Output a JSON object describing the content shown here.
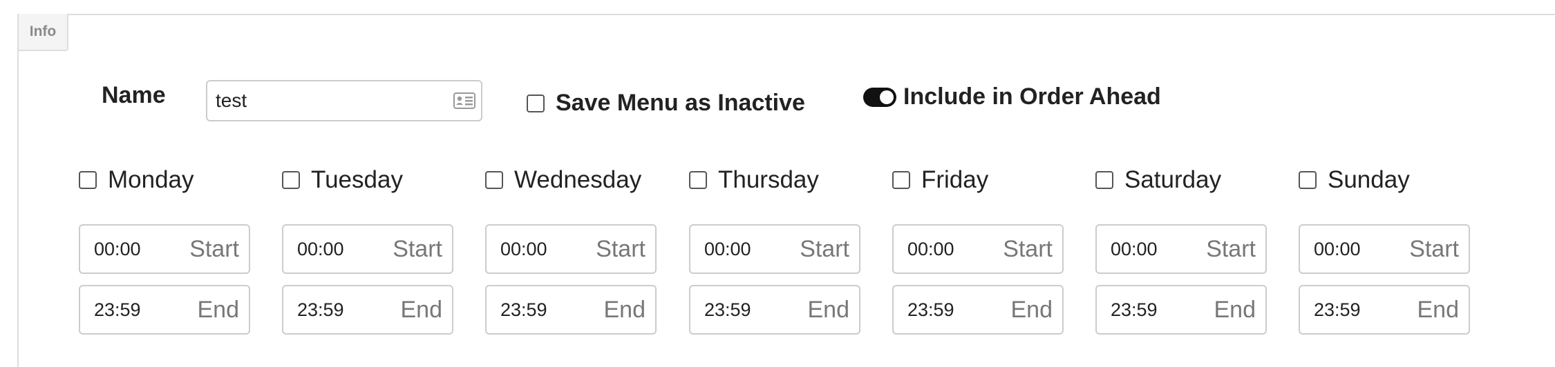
{
  "tab": {
    "label": "Info"
  },
  "name": {
    "label": "Name",
    "value": "test",
    "icon": "contact-card-icon"
  },
  "inactive": {
    "label": "Save Menu as Inactive",
    "checked": false
  },
  "order_ahead": {
    "label": "Include in Order Ahead",
    "enabled": true
  },
  "days": [
    {
      "label": "Monday",
      "checked": false,
      "start": "00:00",
      "start_tag": "Start",
      "end": "23:59",
      "end_tag": "End"
    },
    {
      "label": "Tuesday",
      "checked": false,
      "start": "00:00",
      "start_tag": "Start",
      "end": "23:59",
      "end_tag": "End"
    },
    {
      "label": "Wednesday",
      "checked": false,
      "start": "00:00",
      "start_tag": "Start",
      "end": "23:59",
      "end_tag": "End"
    },
    {
      "label": "Thursday",
      "checked": false,
      "start": "00:00",
      "start_tag": "Start",
      "end": "23:59",
      "end_tag": "End"
    },
    {
      "label": "Friday",
      "checked": false,
      "start": "00:00",
      "start_tag": "Start",
      "end": "23:59",
      "end_tag": "End"
    },
    {
      "label": "Saturday",
      "checked": false,
      "start": "00:00",
      "start_tag": "Start",
      "end": "23:59",
      "end_tag": "End"
    },
    {
      "label": "Sunday",
      "checked": false,
      "start": "00:00",
      "start_tag": "Start",
      "end": "23:59",
      "end_tag": "End"
    }
  ],
  "colors": {
    "toggle_on": "#111111",
    "border": "#cccccc",
    "muted_text": "#777777"
  }
}
